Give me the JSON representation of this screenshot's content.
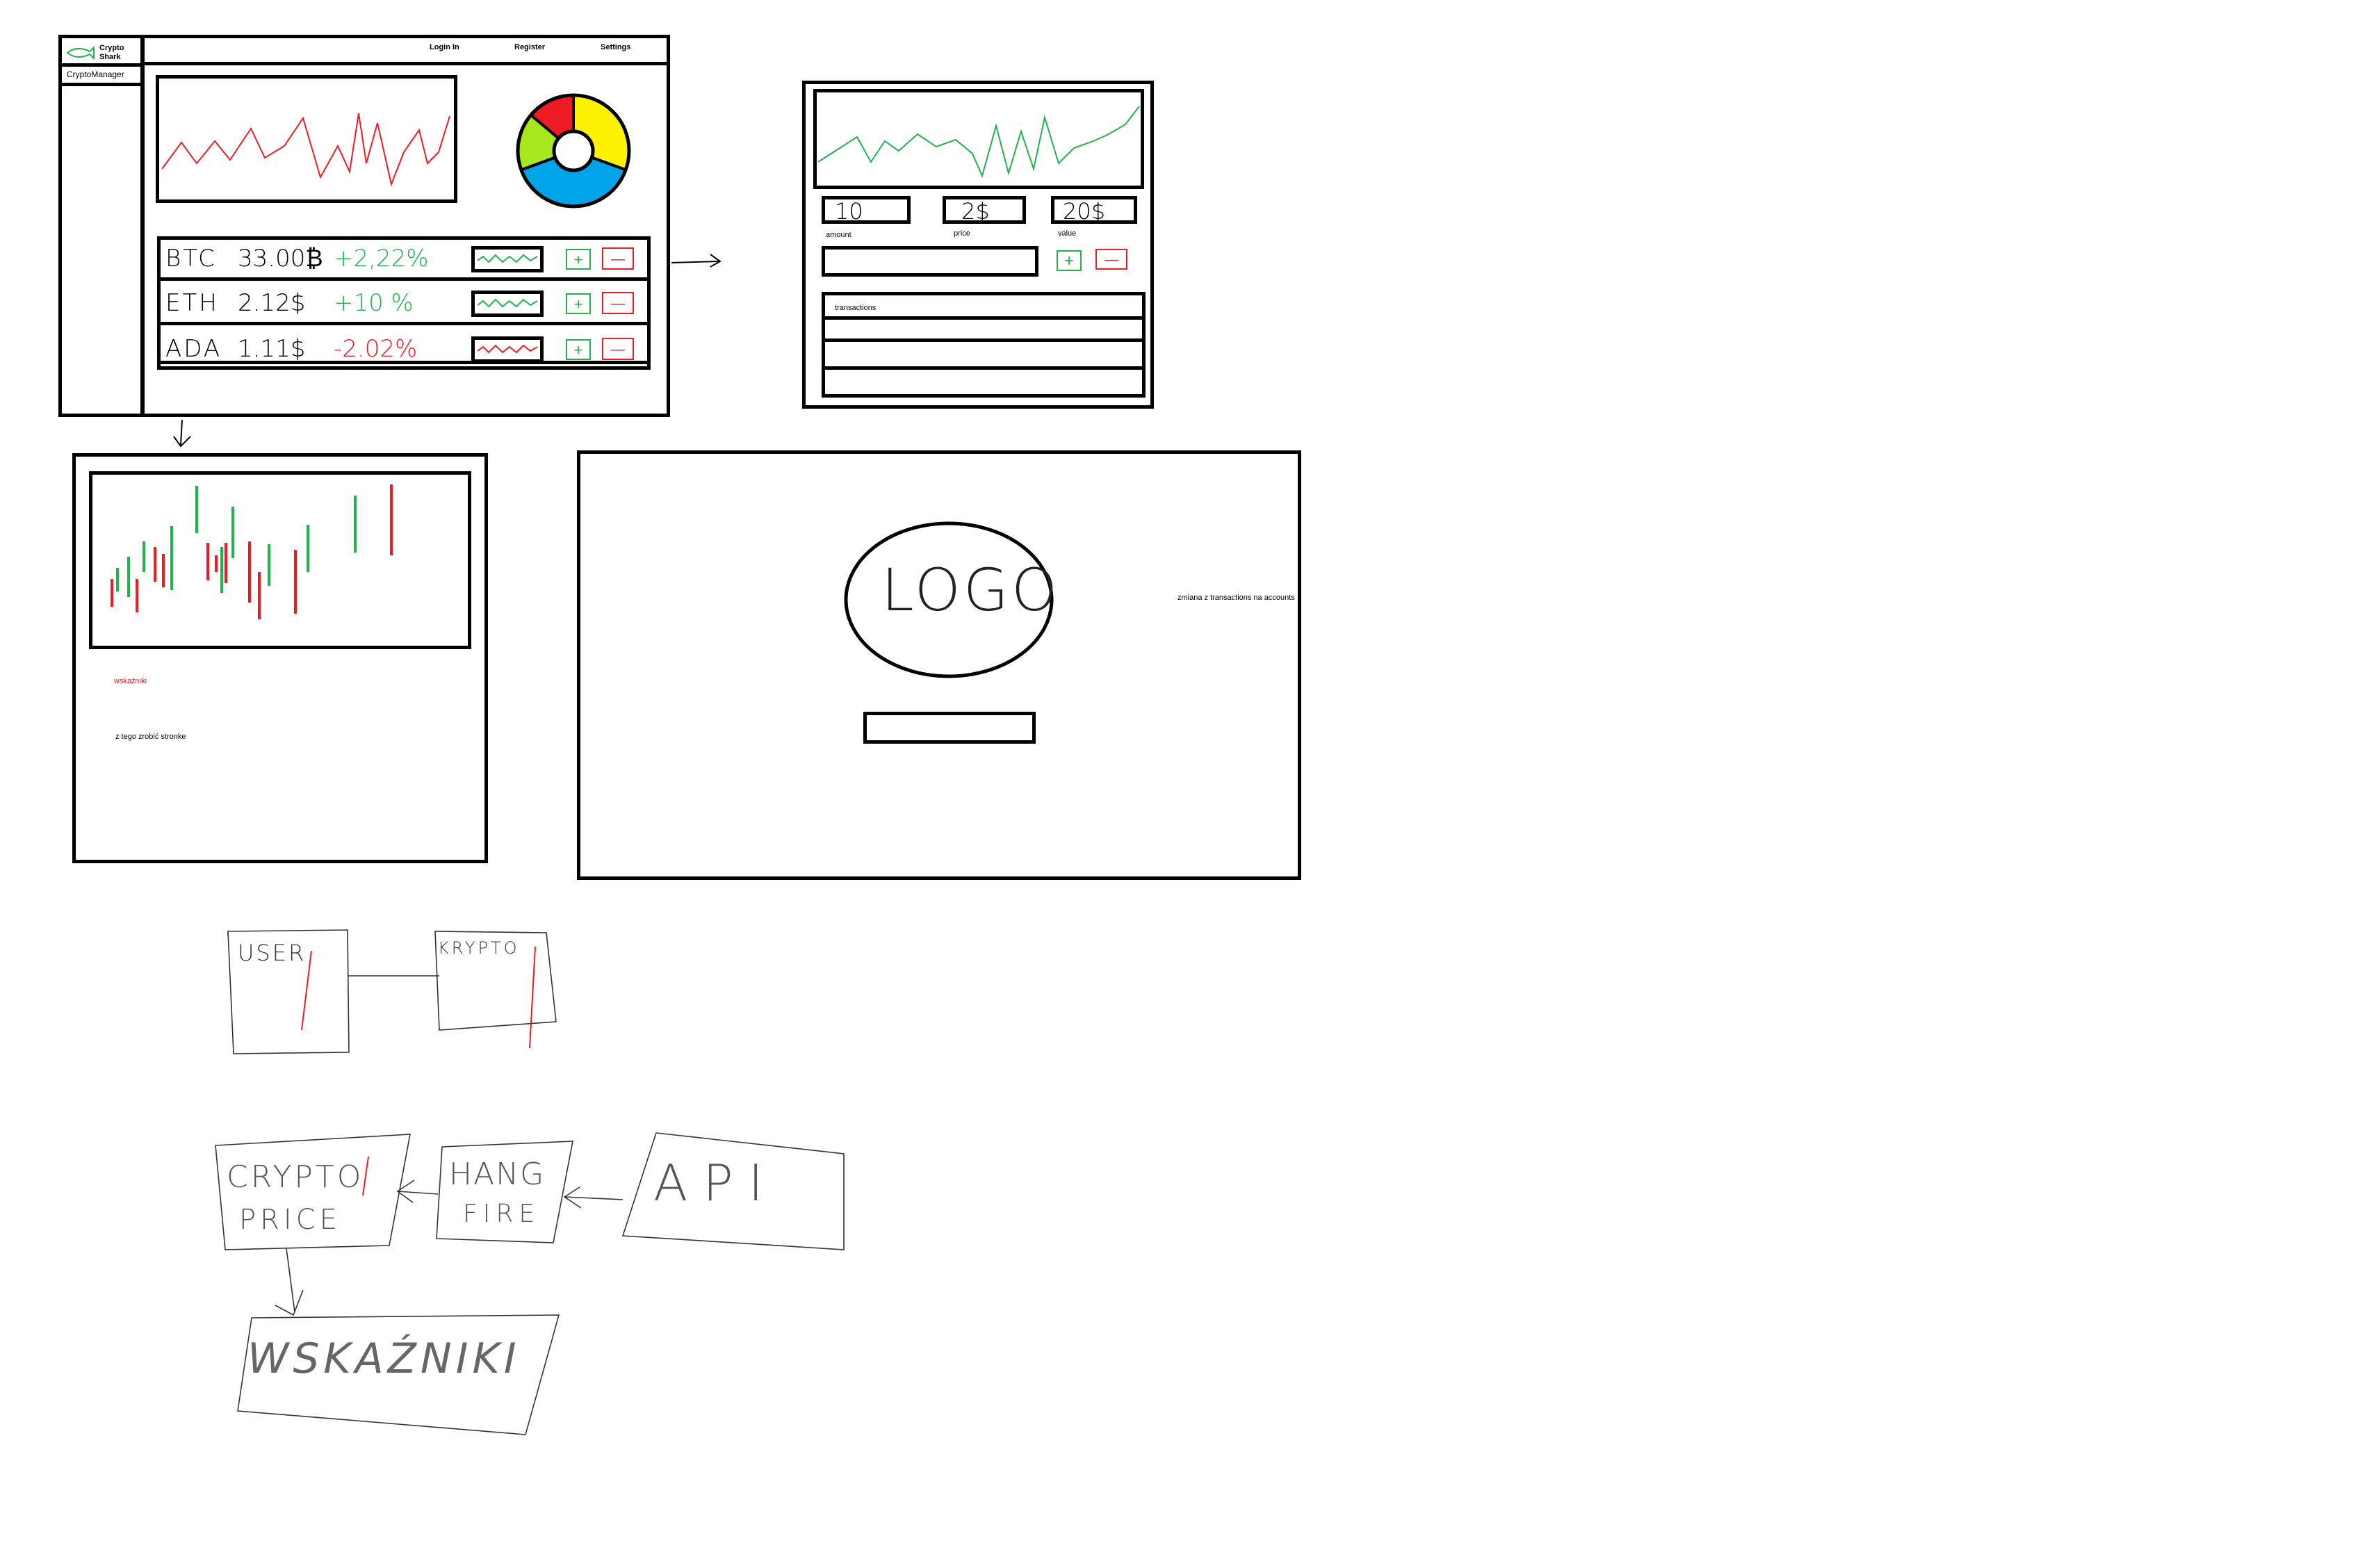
{
  "app": {
    "brand_line1": "Crypto",
    "brand_line2": "Shark",
    "sidebar_item": "CryptoManager",
    "nav": {
      "login": "Login In",
      "register": "Register",
      "settings": "Settings"
    }
  },
  "colors": {
    "rise": "#22b14c",
    "fall": "#ed1c24",
    "pie": [
      "#ed1c24",
      "#fff200",
      "#00a2e8",
      "#a8e61d"
    ]
  },
  "coins": [
    {
      "symbol": "BTC",
      "price": "33.00₿",
      "change": "+2,22%",
      "trend": "up"
    },
    {
      "symbol": "ETH",
      "price": "2.12$",
      "change": "+10 %",
      "trend": "up"
    },
    {
      "symbol": "ADA",
      "price": "1.11$",
      "change": "-2.02%",
      "trend": "down"
    }
  ],
  "buttons": {
    "add": "+",
    "remove": "—"
  },
  "trade": {
    "amount_value": "10",
    "amount_label": "amount",
    "price_value": "2$",
    "price_label": "price",
    "value_value": "20$",
    "value_label": "value",
    "transactions_label": "transactions"
  },
  "indicators": {
    "title": "wskaźniki",
    "note": "z tego zrobić stronke"
  },
  "login": {
    "logo": "LOGO",
    "note": "zmiana z transactions na accounts"
  },
  "diagram": {
    "user": "USER",
    "crypto": "KRYPTO",
    "crypto_price_line1": "CRYPTO",
    "crypto_price_line2": "PRICE",
    "hangfire_line1": "HANG",
    "hangfire_line2": "FIRE",
    "api": "API",
    "wskazniki": "WSKAŹNIKI"
  }
}
